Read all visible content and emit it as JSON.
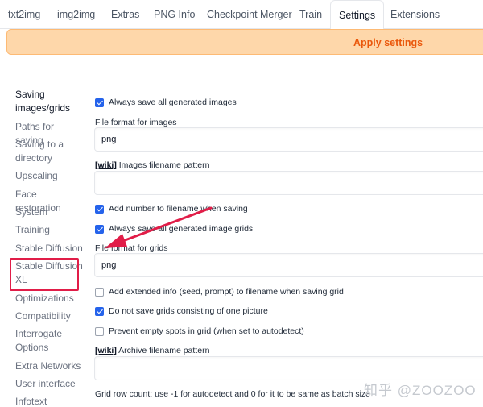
{
  "tabs": [
    "txt2img",
    "img2img",
    "Extras",
    "PNG Info",
    "Checkpoint Merger",
    "Train",
    "Settings",
    "Extensions"
  ],
  "apply_button": "Apply settings",
  "sidebar": {
    "items": [
      "Saving images/grids",
      "Paths for saving",
      "Saving to a directory",
      "Upscaling",
      "Face restoration",
      "System",
      "Training",
      "Stable Diffusion",
      "Stable Diffusion XL",
      "Optimizations",
      "Compatibility",
      "Interrogate Options",
      "Extra Networks",
      "User interface",
      "Infotext"
    ]
  },
  "settings": {
    "always_save_all": {
      "label": "Always save all generated images",
      "checked": true
    },
    "file_format_images": {
      "label": "File format for images",
      "value": "png"
    },
    "images_filename_pattern": {
      "wiki": "[wiki]",
      "label": " Images filename pattern",
      "value": ""
    },
    "add_number": {
      "label": "Add number to filename when saving",
      "checked": true
    },
    "always_save_grids": {
      "label": "Always save all generated image grids",
      "checked": true
    },
    "file_format_grids": {
      "label": "File format for grids",
      "value": "png"
    },
    "extended_info": {
      "label": "Add extended info (seed, prompt) to filename when saving grid",
      "checked": false
    },
    "no_single_grid": {
      "label": "Do not save grids consisting of one picture",
      "checked": true
    },
    "prevent_empty_spots": {
      "label": "Prevent empty spots in grid (when set to autodetect)",
      "checked": false
    },
    "archive_filename_pattern": {
      "wiki": "[wiki]",
      "label": " Archive filename pattern",
      "value": ""
    },
    "grid_row_count": {
      "label": "Grid row count; use -1 for autodetect and 0 for it to be same as batch size"
    }
  },
  "watermark": "知乎 @ZOOZOO",
  "colors": {
    "accent": "#2563eb",
    "apply_bg": "#fed7aa",
    "apply_text": "#ea580c",
    "annotation": "#e11d48"
  }
}
